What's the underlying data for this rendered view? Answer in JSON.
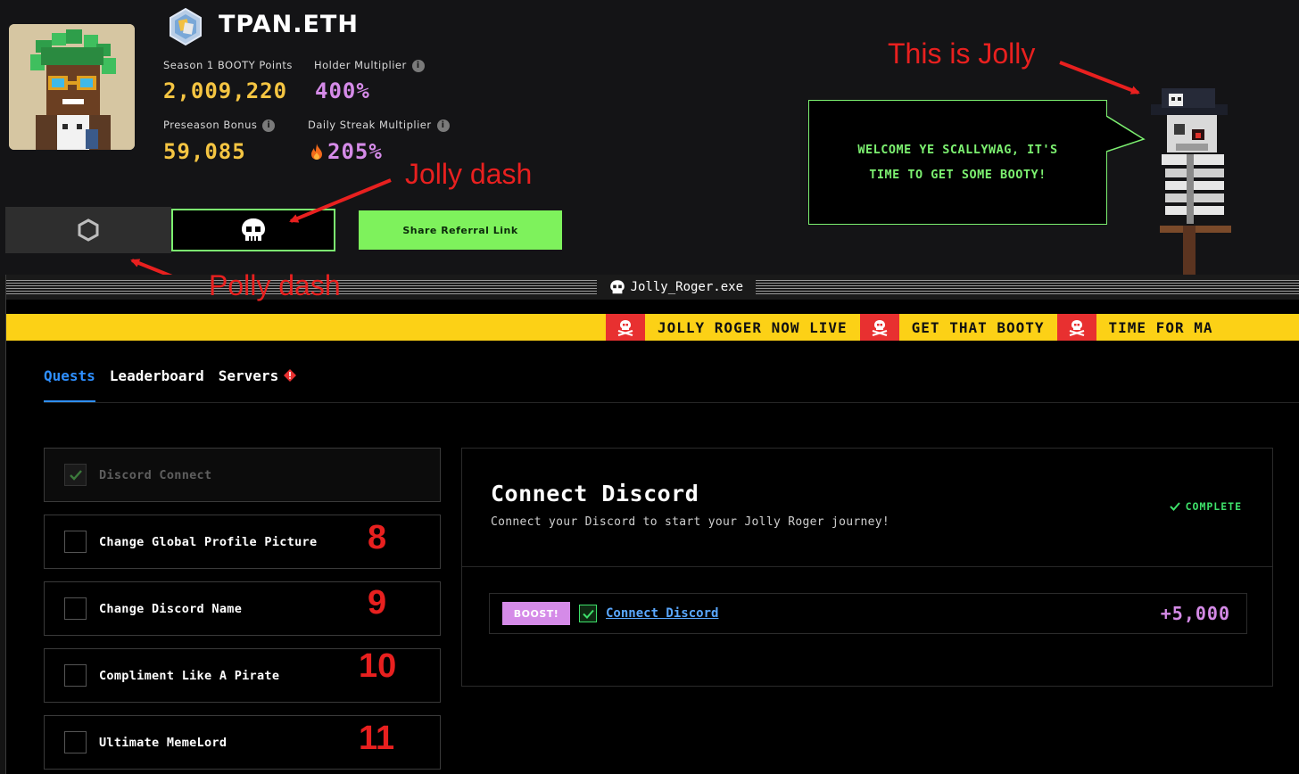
{
  "profile": {
    "username": "TPAN.ETH",
    "avatar_icon": "pixel-avatar",
    "badge_icon": "profile-badge-icon",
    "stats": [
      {
        "label": "Season 1 BOOTY Points",
        "value": "2,009,220",
        "color": "#f5c542",
        "info": false
      },
      {
        "label": "Holder Multiplier",
        "value": "400%",
        "color": "#d58be8",
        "info": true
      },
      {
        "label": "Preseason Bonus",
        "value": "59,085",
        "color": "#f5c542",
        "info": true
      },
      {
        "label": "Daily Streak Multiplier",
        "value": "205%",
        "color": "#d58be8",
        "info": true,
        "prefix_icon": "fire-icon"
      }
    ]
  },
  "dash_tabs": {
    "polly_icon": "hexagon-icon",
    "jolly_icon": "skull-icon",
    "share_label": "Share Referral Link"
  },
  "jolly": {
    "speech_line1": "WELCOME YE SCALLYWAG, IT'S",
    "speech_line2": "TIME TO GET SOME BOOTY!"
  },
  "annotations": {
    "this_is_jolly": "This is Jolly",
    "jolly_dash": "Jolly dash",
    "polly_dash": "Polly dash",
    "numbers": [
      "8",
      "9",
      "10",
      "11"
    ]
  },
  "window": {
    "title": "Jolly_Roger.exe",
    "ticker": [
      "JOLLY ROGER NOW LIVE",
      "GET THAT BOOTY",
      "TIME FOR MA"
    ]
  },
  "tabs": [
    {
      "label": "Quests",
      "active": true
    },
    {
      "label": "Leaderboard",
      "active": false
    },
    {
      "label": "Servers",
      "active": false
    }
  ],
  "quests": [
    {
      "label": "Discord Connect",
      "done": true
    },
    {
      "label": "Change Global Profile Picture",
      "done": false
    },
    {
      "label": "Change Discord Name",
      "done": false
    },
    {
      "label": "Compliment Like A Pirate",
      "done": false
    },
    {
      "label": "Ultimate MemeLord",
      "done": false
    }
  ],
  "detail": {
    "title": "Connect Discord",
    "subtitle": "Connect your Discord to start your Jolly Roger journey!",
    "status": "COMPLETE",
    "boost_label": "BOOST!",
    "task_label": "Connect Discord",
    "task_points": "+5,000"
  },
  "colors": {
    "accent_green": "#7cf070",
    "booty_yellow": "#f5c542",
    "multiplier_purple": "#d58be8",
    "tab_blue": "#2e8fff",
    "ticker_yellow": "#fcd116",
    "annotation_red": "#e8201f"
  }
}
